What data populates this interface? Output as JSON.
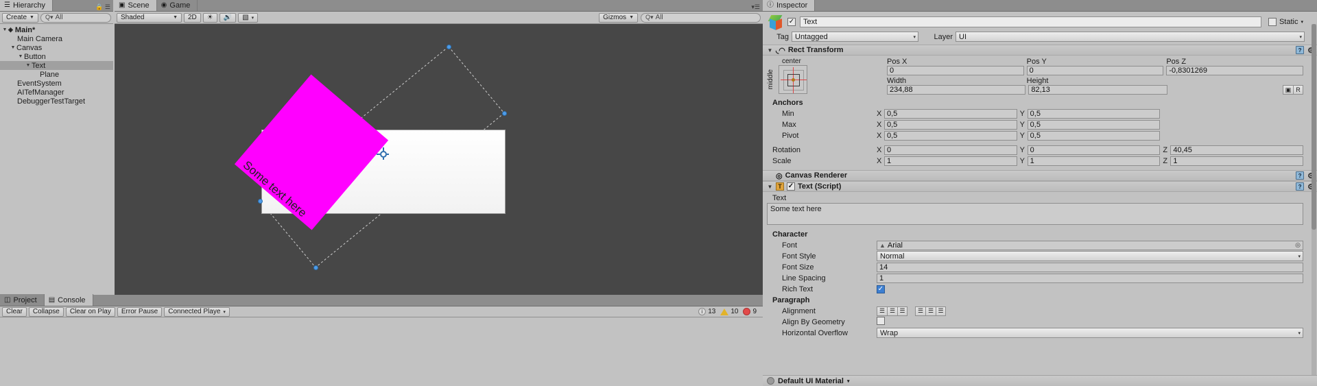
{
  "hierarchy": {
    "tab_label": "Hierarchy",
    "tab_icon": "hierarchy-icon",
    "create_label": "Create",
    "search_placeholder": "All",
    "search_icon": "search-icon",
    "items": [
      {
        "label": "Main*",
        "depth": 0,
        "arrow": "▼",
        "icon": "unity-scene-icon",
        "selected": false,
        "bold": true
      },
      {
        "label": "Main Camera",
        "depth": 1,
        "arrow": "",
        "icon": "",
        "selected": false,
        "bold": false
      },
      {
        "label": "Canvas",
        "depth": 1,
        "arrow": "▼",
        "icon": "",
        "selected": false,
        "bold": false
      },
      {
        "label": "Button",
        "depth": 2,
        "arrow": "▼",
        "icon": "",
        "selected": false,
        "bold": false
      },
      {
        "label": "Text",
        "depth": 3,
        "arrow": "▼",
        "icon": "",
        "selected": true,
        "bold": false
      },
      {
        "label": "Plane",
        "depth": 4,
        "arrow": "",
        "icon": "",
        "selected": false,
        "bold": false
      },
      {
        "label": "EventSystem",
        "depth": 1,
        "arrow": "",
        "icon": "",
        "selected": false,
        "bold": false
      },
      {
        "label": "AITefManager",
        "depth": 1,
        "arrow": "",
        "icon": "",
        "selected": false,
        "bold": false
      },
      {
        "label": "DebuggerTestTarget",
        "depth": 1,
        "arrow": "",
        "icon": "",
        "selected": false,
        "bold": false
      }
    ]
  },
  "scene": {
    "tabs": [
      {
        "label": "Scene",
        "icon": "scene-icon",
        "active": true
      },
      {
        "label": "Game",
        "icon": "game-icon",
        "active": false
      }
    ],
    "toolbar": {
      "shading_mode": "Shaded",
      "dimension_mode": "2D",
      "lighting_icon": "sun-icon",
      "audio_icon": "speaker-icon",
      "fx_icon": "image-icon",
      "fx_caret": "▾",
      "gizmos_label": "Gizmos",
      "search_placeholder": "All",
      "search_icon": "search-icon"
    },
    "text_object_label": "Some text here",
    "background_color": "#474747",
    "highlight_color": "#ff00ff",
    "handle_color": "#4f9ce8"
  },
  "bottom": {
    "tabs": [
      {
        "label": "Project",
        "icon": "project-icon",
        "active": false
      },
      {
        "label": "Console",
        "icon": "console-icon",
        "active": true
      }
    ],
    "toolbar": {
      "clear_label": "Clear",
      "collapse_label": "Collapse",
      "clear_on_play_label": "Clear on Play",
      "error_pause_label": "Error Pause",
      "connected_player_label": "Connected Playe",
      "connected_player_caret": "▾"
    },
    "counts": {
      "info": "13",
      "warning": "10",
      "error": "9"
    }
  },
  "inspector": {
    "tab_label": "Inspector",
    "tab_icon": "info-icon",
    "object_name": "Text",
    "object_enabled": true,
    "static_label": "Static",
    "static_caret": "▾",
    "tag_label": "Tag",
    "tag_value": "Untagged",
    "layer_label": "Layer",
    "layer_value": "UI",
    "rect_transform": {
      "title": "Rect Transform",
      "anchor_preset_top": "center",
      "anchor_preset_left": "middle",
      "pos_x_label": "Pos X",
      "pos_y_label": "Pos Y",
      "pos_z_label": "Pos Z",
      "pos_x": "0",
      "pos_y": "0",
      "pos_z": "-0,8301269",
      "width_label": "Width",
      "height_label": "Height",
      "width": "234,88",
      "height": "82,13",
      "blueprint_label": "R",
      "anchors_label": "Anchors",
      "min_label": "Min",
      "max_label": "Max",
      "pivot_label": "Pivot",
      "min_x": "0,5",
      "min_y": "0,5",
      "max_x": "0,5",
      "max_y": "0,5",
      "pivot_x": "0,5",
      "pivot_y": "0,5",
      "rotation_label": "Rotation",
      "rot_x": "0",
      "rot_y": "0",
      "rot_z": "40,45",
      "scale_label": "Scale",
      "scale_x": "1",
      "scale_y": "1",
      "scale_z": "1",
      "axis_x": "X",
      "axis_y": "Y",
      "axis_z": "Z"
    },
    "canvas_renderer": {
      "title": "Canvas Renderer"
    },
    "text_script": {
      "title": "Text (Script)",
      "icon_letter": "T",
      "enabled": true,
      "text_label": "Text",
      "text_value": "Some text here",
      "character_label": "Character",
      "font_label": "Font",
      "font_value": "Arial",
      "font_icon": "font-asset-icon",
      "font_picker_icon": "◉",
      "font_style_label": "Font Style",
      "font_style_value": "Normal",
      "font_size_label": "Font Size",
      "font_size_value": "14",
      "line_spacing_label": "Line Spacing",
      "line_spacing_value": "1",
      "rich_text_label": "Rich Text",
      "rich_text_checked": true,
      "paragraph_label": "Paragraph",
      "alignment_label": "Alignment",
      "alignment_h_icons": [
        "align-left-icon",
        "align-center-icon",
        "align-right-icon"
      ],
      "alignment_v_icons": [
        "align-top-icon",
        "align-middle-icon",
        "align-bottom-icon"
      ],
      "align_by_geometry_label": "Align By Geometry",
      "align_by_geometry_checked": false,
      "horizontal_overflow_label": "Horizontal Overflow",
      "horizontal_overflow_value": "Wrap"
    },
    "footer_material": "Default UI Material",
    "footer_caret": "▾"
  }
}
